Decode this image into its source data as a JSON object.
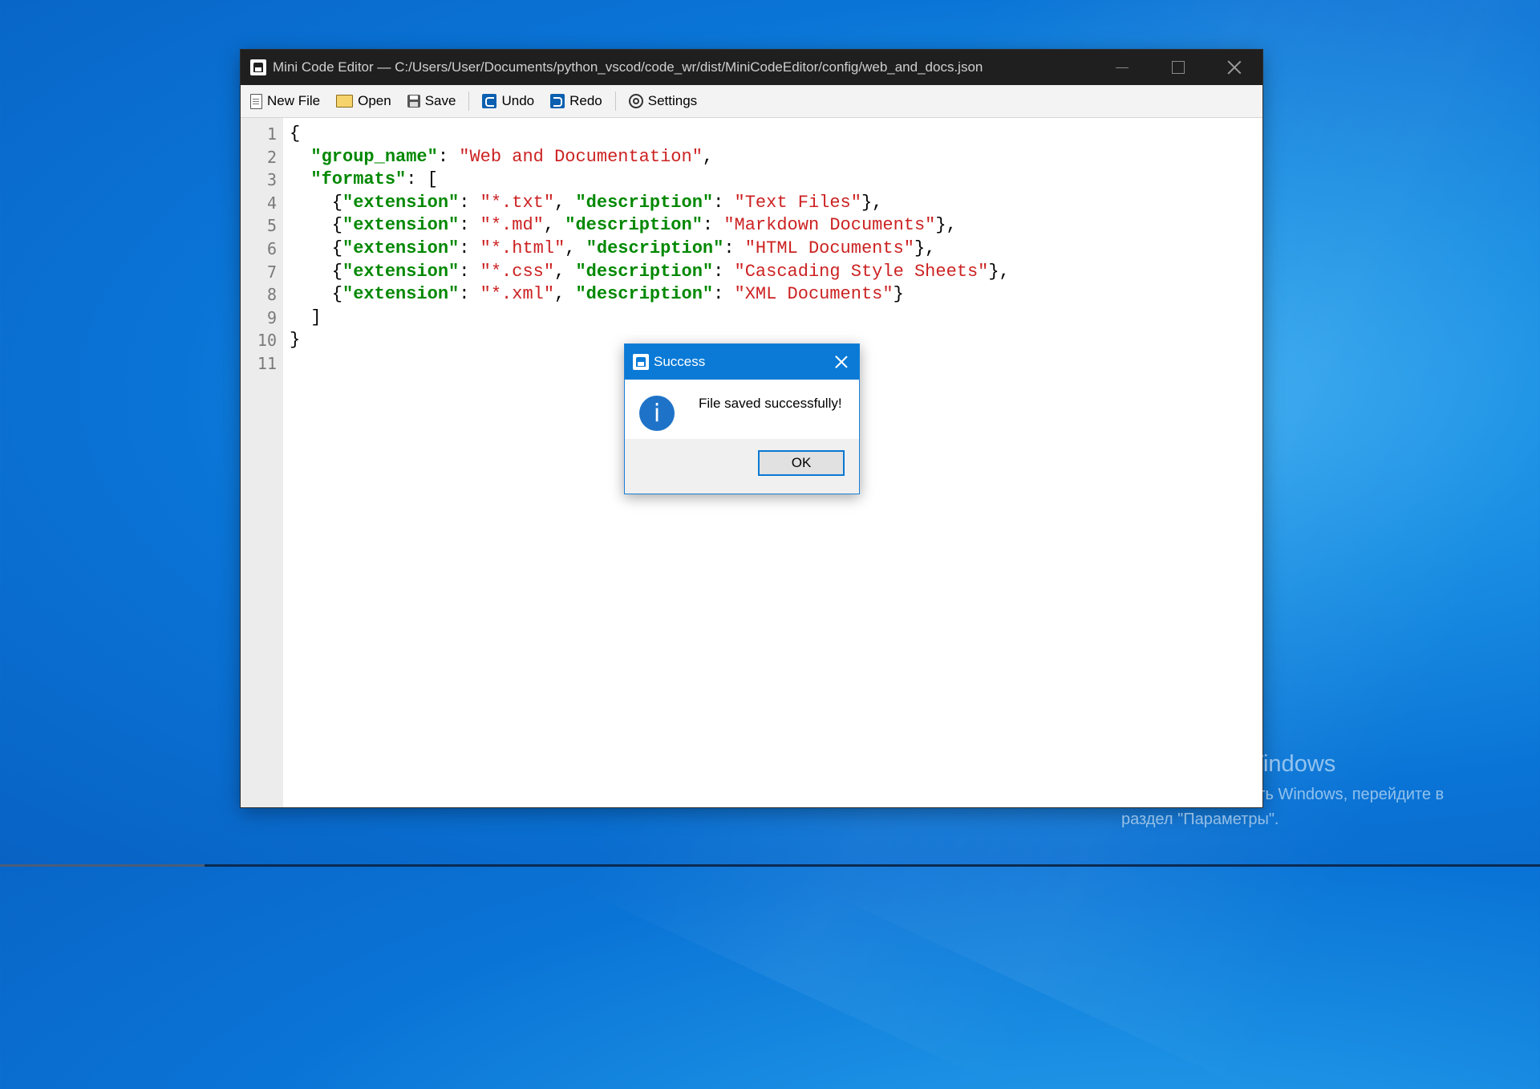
{
  "window": {
    "title": "Mini Code Editor — C:/Users/User/Documents/python_vscod/code_wr/dist/MiniCodeEditor/config/web_and_docs.json"
  },
  "toolbar": {
    "new_file": "New File",
    "open": "Open",
    "save": "Save",
    "undo": "Undo",
    "redo": "Redo",
    "settings": "Settings"
  },
  "editor": {
    "line_numbers": [
      "1",
      "2",
      "3",
      "4",
      "5",
      "6",
      "7",
      "8",
      "9",
      "10",
      "11"
    ],
    "lines": [
      [
        {
          "t": "{",
          "c": "p"
        }
      ],
      [
        {
          "t": "  ",
          "c": "p"
        },
        {
          "t": "\"group_name\"",
          "c": "k"
        },
        {
          "t": ": ",
          "c": "p"
        },
        {
          "t": "\"Web and Documentation\"",
          "c": "s"
        },
        {
          "t": ",",
          "c": "p"
        }
      ],
      [
        {
          "t": "  ",
          "c": "p"
        },
        {
          "t": "\"formats\"",
          "c": "k"
        },
        {
          "t": ": [",
          "c": "p"
        }
      ],
      [
        {
          "t": "    {",
          "c": "p"
        },
        {
          "t": "\"extension\"",
          "c": "k"
        },
        {
          "t": ": ",
          "c": "p"
        },
        {
          "t": "\"*.txt\"",
          "c": "s"
        },
        {
          "t": ", ",
          "c": "p"
        },
        {
          "t": "\"description\"",
          "c": "k"
        },
        {
          "t": ": ",
          "c": "p"
        },
        {
          "t": "\"Text Files\"",
          "c": "s"
        },
        {
          "t": "},",
          "c": "p"
        }
      ],
      [
        {
          "t": "    {",
          "c": "p"
        },
        {
          "t": "\"extension\"",
          "c": "k"
        },
        {
          "t": ": ",
          "c": "p"
        },
        {
          "t": "\"*.md\"",
          "c": "s"
        },
        {
          "t": ", ",
          "c": "p"
        },
        {
          "t": "\"description\"",
          "c": "k"
        },
        {
          "t": ": ",
          "c": "p"
        },
        {
          "t": "\"Markdown Documents\"",
          "c": "s"
        },
        {
          "t": "},",
          "c": "p"
        }
      ],
      [
        {
          "t": "    {",
          "c": "p"
        },
        {
          "t": "\"extension\"",
          "c": "k"
        },
        {
          "t": ": ",
          "c": "p"
        },
        {
          "t": "\"*.html\"",
          "c": "s"
        },
        {
          "t": ", ",
          "c": "p"
        },
        {
          "t": "\"description\"",
          "c": "k"
        },
        {
          "t": ": ",
          "c": "p"
        },
        {
          "t": "\"HTML Documents\"",
          "c": "s"
        },
        {
          "t": "},",
          "c": "p"
        }
      ],
      [
        {
          "t": "    {",
          "c": "p"
        },
        {
          "t": "\"extension\"",
          "c": "k"
        },
        {
          "t": ": ",
          "c": "p"
        },
        {
          "t": "\"*.css\"",
          "c": "s"
        },
        {
          "t": ", ",
          "c": "p"
        },
        {
          "t": "\"description\"",
          "c": "k"
        },
        {
          "t": ": ",
          "c": "p"
        },
        {
          "t": "\"Cascading Style Sheets\"",
          "c": "s"
        },
        {
          "t": "},",
          "c": "p"
        }
      ],
      [
        {
          "t": "    {",
          "c": "p"
        },
        {
          "t": "\"extension\"",
          "c": "k"
        },
        {
          "t": ": ",
          "c": "p"
        },
        {
          "t": "\"*.xml\"",
          "c": "s"
        },
        {
          "t": ", ",
          "c": "p"
        },
        {
          "t": "\"description\"",
          "c": "k"
        },
        {
          "t": ": ",
          "c": "p"
        },
        {
          "t": "\"XML Documents\"",
          "c": "s"
        },
        {
          "t": "}",
          "c": "p"
        }
      ],
      [
        {
          "t": "  ]",
          "c": "p"
        }
      ],
      [
        {
          "t": "}",
          "c": "p"
        }
      ],
      []
    ]
  },
  "dialog": {
    "title": "Success",
    "message": "File saved successfully!",
    "info_glyph": "i",
    "ok_label": "OK"
  },
  "watermark": {
    "title": "Активация Windows",
    "line1": "Чтобы активировать Windows, перейдите в",
    "line2": "раздел \"Параметры\"."
  },
  "colors": {
    "titlebar": "#1f1f1f",
    "dialog_title": "#0a7ad6",
    "json_key": "#008800",
    "json_string": "#cc2222"
  }
}
